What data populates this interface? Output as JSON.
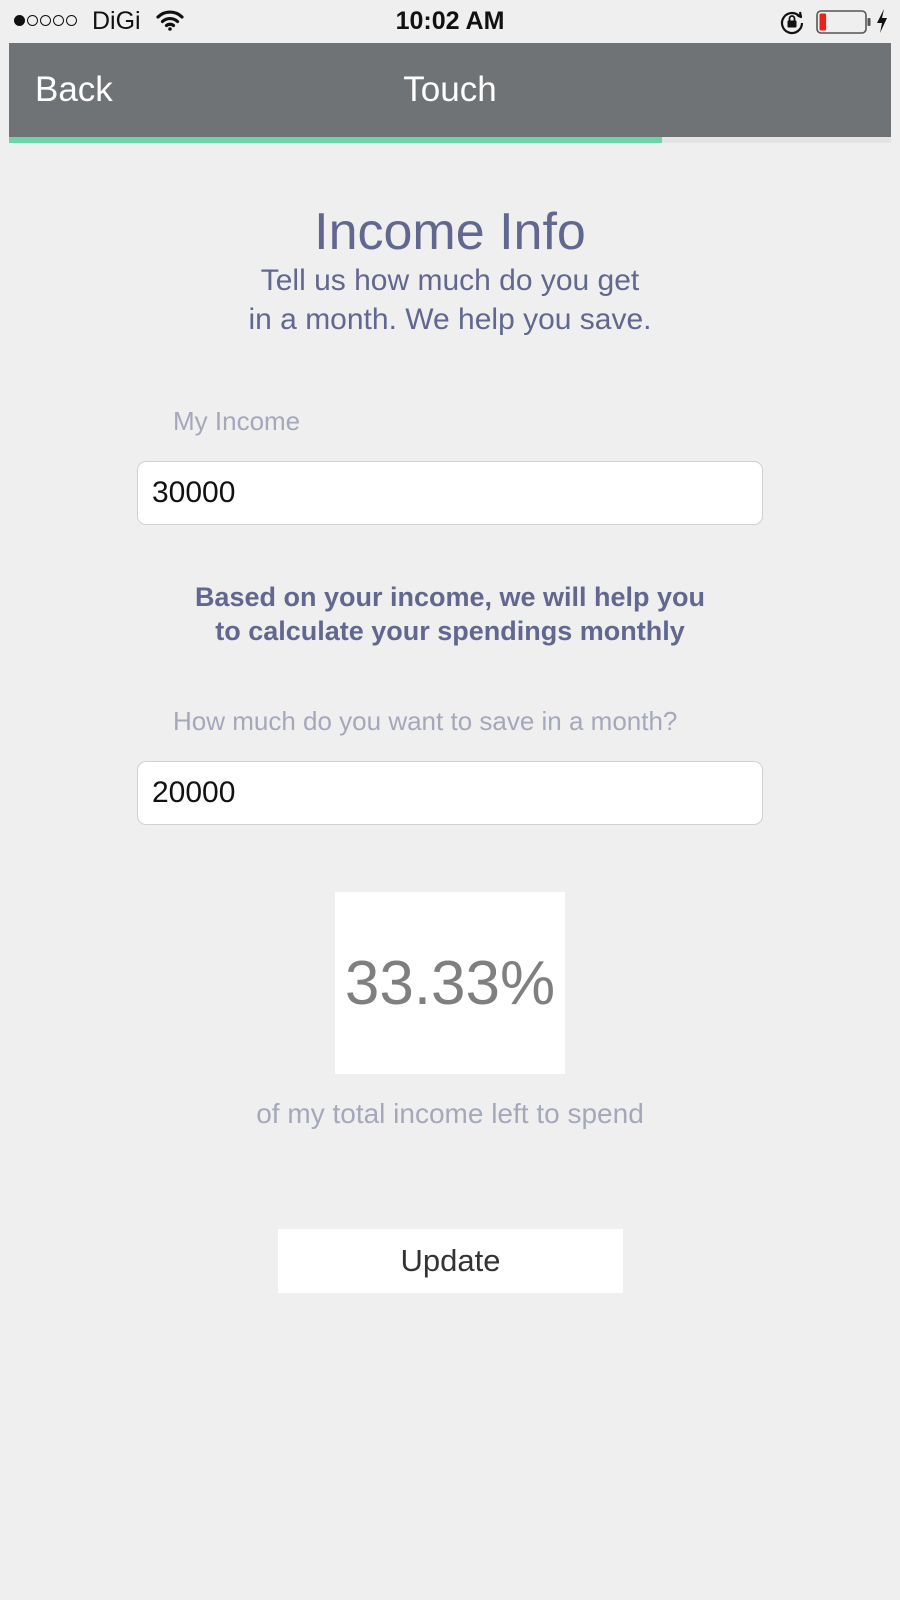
{
  "status_bar": {
    "carrier": "DiGi",
    "time": "10:02 AM",
    "signal_bars_filled": 1,
    "signal_bars_total": 5,
    "battery_level": 0.15,
    "battery_color": "#e8231a"
  },
  "nav": {
    "back_label": "Back",
    "title": "Touch",
    "progress": 0.74,
    "progress_color": "#6dd3a8",
    "bar_color": "#707376"
  },
  "header": {
    "title": "Income Info",
    "subtitle_line1": "Tell us how much do you get",
    "subtitle_line2": "in a month. We help you save."
  },
  "income": {
    "label": "My Income",
    "value": "30000"
  },
  "info": {
    "line1": "Based on your income, we will help you",
    "line2": "to calculate your spendings monthly"
  },
  "savings": {
    "label": "How much do you want to save in a month?",
    "value": "20000"
  },
  "result": {
    "percentage": "33.33%",
    "caption": "of my total income left to spend"
  },
  "actions": {
    "update_label": "Update"
  },
  "colors": {
    "accent_text": "#62678f",
    "muted_text": "#a5a8bb",
    "background": "#efefef"
  }
}
